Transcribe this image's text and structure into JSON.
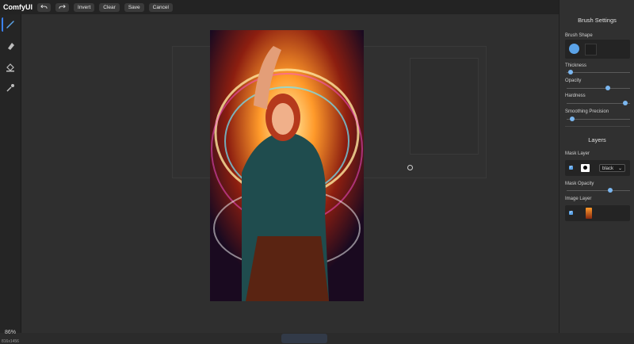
{
  "topbar": {
    "logo": "ComfyUI",
    "undo_icon": "undo-icon",
    "redo_icon": "redo-icon",
    "invert_label": "Invert",
    "clear_label": "Clear",
    "save_label": "Save",
    "cancel_label": "Cancel"
  },
  "tools": [
    {
      "name": "brush-icon",
      "active": true
    },
    {
      "name": "eraser-icon",
      "active": false
    },
    {
      "name": "paint-bucket-icon",
      "active": false
    },
    {
      "name": "color-picker-icon",
      "active": false
    }
  ],
  "status": {
    "zoom": "86%",
    "dimensions": "816x1456"
  },
  "brush_settings": {
    "title": "Brush Settings",
    "shape_label": "Brush Shape",
    "thickness_label": "Thickness",
    "thickness_value": 0.03,
    "opacity_label": "Opacity",
    "opacity_value": 0.66,
    "hardness_label": "Hardness",
    "hardness_value": 0.96,
    "smoothing_label": "Smoothing Precision",
    "smoothing_value": 0.06
  },
  "layers": {
    "title": "Layers",
    "mask_layer_label": "Mask Layer",
    "mask_layer_checked": true,
    "mask_blend_value": "black",
    "mask_opacity_label": "Mask Opacity",
    "mask_opacity_value": 0.7,
    "image_layer_label": "Image Layer",
    "image_layer_checked": true
  },
  "colors": {
    "accent": "#5ba3e8",
    "background": "#2b2b2b",
    "panel": "#303030"
  }
}
